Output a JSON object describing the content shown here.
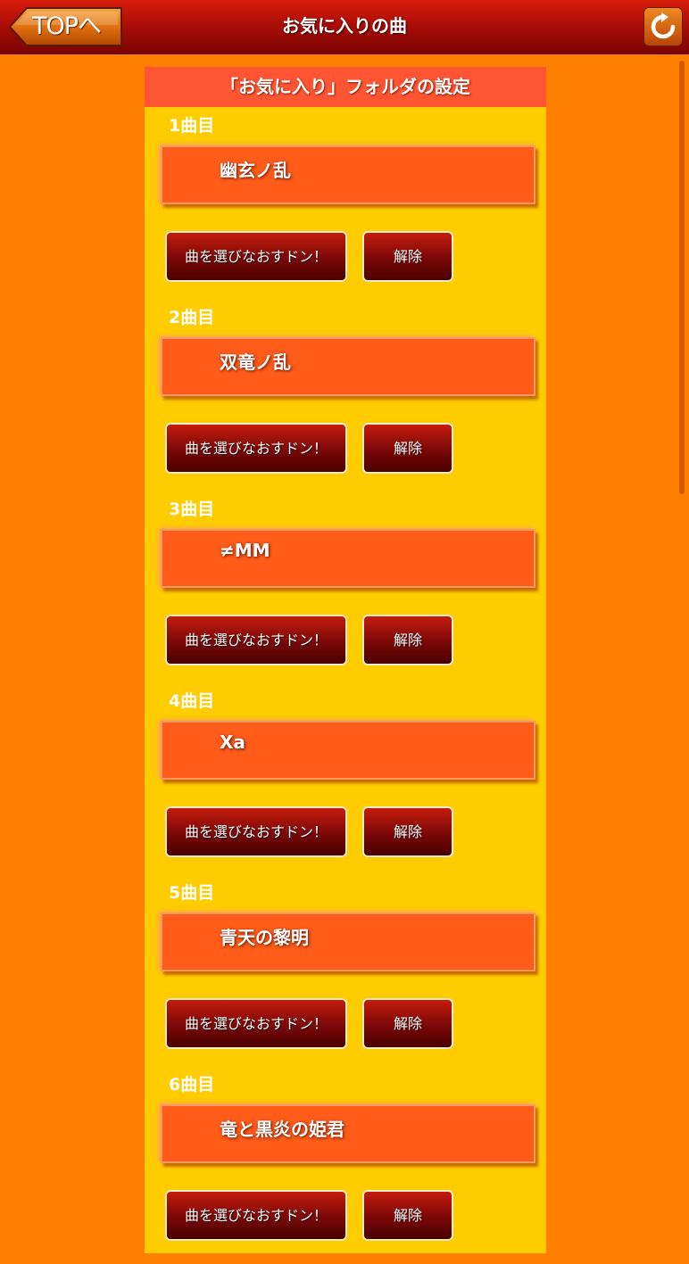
{
  "header": {
    "title": "お気に入りの曲",
    "top_button": "TOPへ",
    "reload_icon": "reload-icon"
  },
  "panel": {
    "title": "「お気に入り」フォルダの設定"
  },
  "slots": [
    {
      "label": "1曲目",
      "song": "幽玄ノ乱",
      "reselect": "曲を選びなおすドン！",
      "release": "解除"
    },
    {
      "label": "2曲目",
      "song": "双竜ノ乱",
      "reselect": "曲を選びなおすドン！",
      "release": "解除"
    },
    {
      "label": "3曲目",
      "song": "≠MM",
      "reselect": "曲を選びなおすドン！",
      "release": "解除"
    },
    {
      "label": "4曲目",
      "song": "Xa",
      "reselect": "曲を選びなおすドン！",
      "release": "解除"
    },
    {
      "label": "5曲目",
      "song": "青天の黎明",
      "reselect": "曲を選びなおすドン！",
      "release": "解除"
    },
    {
      "label": "6曲目",
      "song": "竜と黒炎の姫君",
      "reselect": "曲を選びなおすドン！",
      "release": "解除"
    }
  ],
  "colors": {
    "background": "#ff7f00",
    "panel": "#ffcc00",
    "panel_header": "#ff5533",
    "song_box": "#ff5b19",
    "button": "#7a0808"
  }
}
